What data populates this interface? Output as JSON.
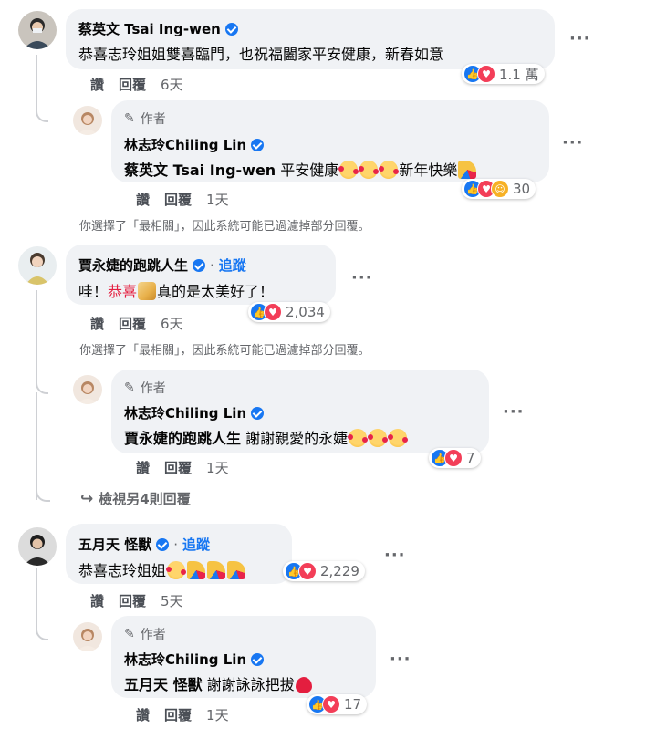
{
  "colors": {
    "accent": "#1877f2",
    "love": "#f33e58",
    "bubble": "#f0f2f5",
    "muted": "#65676b"
  },
  "actions": {
    "like": "讚",
    "reply": "回覆"
  },
  "author_tag": "作者",
  "follow_label": "追蹤",
  "filter_notice": "你選擇了「最相關」，因此系統可能已過濾掉部分回覆。",
  "comments": [
    {
      "name": "蔡英文 Tsai Ing-wen",
      "text": "恭喜志玲姐姐雙喜臨門，也祝福闔家平安健康，新春如意",
      "time": "6天",
      "reactions": {
        "icons": [
          "like-icon",
          "love-icon"
        ],
        "count": "1.1 萬"
      },
      "reply": {
        "name": "林志玲Chiling Lin",
        "mention": "蔡英文 Tsai Ing-wen",
        "text": "平安健康",
        "text2": "新年快樂",
        "time": "1天",
        "reactions": {
          "icons": [
            "like-icon",
            "love-icon",
            "care-icon"
          ],
          "count": "30"
        }
      }
    },
    {
      "name": "賈永婕的跑跳人生",
      "text_a": "哇！",
      "text_red": "恭喜",
      "text_b": "真的是太美好了！",
      "time": "6天",
      "reactions": {
        "icons": [
          "like-icon",
          "love-icon"
        ],
        "count": "2,034"
      },
      "reply": {
        "name": "林志玲Chiling Lin",
        "mention": "賈永婕的跑跳人生",
        "text": "謝謝親愛的永婕",
        "time": "1天",
        "reactions": {
          "icons": [
            "like-icon",
            "love-icon"
          ],
          "count": "7"
        }
      },
      "more_replies": "檢視另4則回覆"
    },
    {
      "name": "五月天 怪獸",
      "text": "恭喜志玲姐姐",
      "time": "5天",
      "reactions": {
        "icons": [
          "like-icon",
          "love-icon"
        ],
        "count": "2,229"
      },
      "reply": {
        "name": "林志玲Chiling Lin",
        "mention": "五月天 怪獸",
        "text": "謝謝詠詠把拔",
        "time": "1天",
        "reactions": {
          "icons": [
            "like-icon",
            "love-icon"
          ],
          "count": "17"
        }
      }
    }
  ]
}
